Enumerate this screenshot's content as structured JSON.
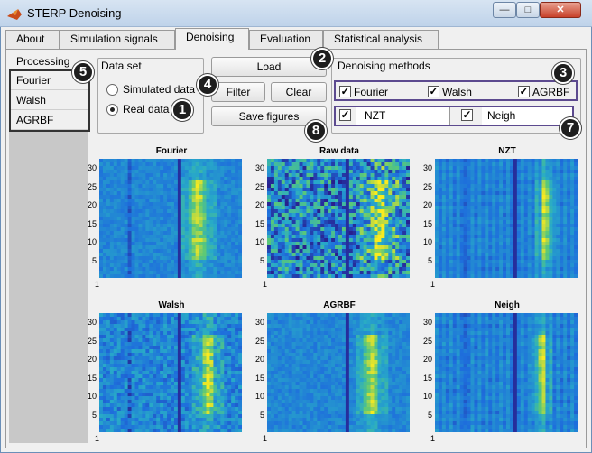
{
  "window": {
    "title": "STERP Denoising",
    "min_symbol": "—",
    "max_symbol": "□",
    "close_symbol": "✕"
  },
  "tabs": [
    {
      "label": "About"
    },
    {
      "label": "Simulation signals"
    },
    {
      "label": "Denoising"
    },
    {
      "label": "Evaluation"
    },
    {
      "label": "Statistical analysis"
    }
  ],
  "processing": {
    "label": "Processing",
    "items": [
      "Fourier",
      "Walsh",
      "AGRBF"
    ]
  },
  "dataset": {
    "title": "Data set",
    "options": [
      "Simulated data",
      "Real data"
    ],
    "selected": "Real data"
  },
  "buttons": {
    "load": "Load",
    "filter": "Filter",
    "clear": "Clear",
    "save": "Save figures"
  },
  "methods": {
    "title": "Denoising methods",
    "row1": [
      {
        "label": "Fourier",
        "checked": true
      },
      {
        "label": "Walsh",
        "checked": true
      },
      {
        "label": "AGRBF",
        "checked": true
      }
    ],
    "row2": [
      {
        "label": "NZT",
        "checked": true
      },
      {
        "label": "Neigh",
        "checked": true
      }
    ]
  },
  "badges": [
    "1",
    "2",
    "3",
    "4",
    "5",
    "7",
    "8"
  ],
  "plots": [
    {
      "title": "Fourier",
      "yticks": [
        "30",
        "25",
        "20",
        "15",
        "10",
        "5"
      ],
      "xtick": "1"
    },
    {
      "title": "Raw data",
      "yticks": [
        "30",
        "25",
        "20",
        "15",
        "10",
        "5"
      ],
      "xtick": "1"
    },
    {
      "title": "NZT",
      "yticks": [
        "30",
        "25",
        "20",
        "15",
        "10",
        "5"
      ],
      "xtick": "1"
    },
    {
      "title": "Walsh",
      "yticks": [
        "30",
        "25",
        "20",
        "15",
        "10",
        "5"
      ],
      "xtick": "1"
    },
    {
      "title": "AGRBF",
      "yticks": [
        "30",
        "25",
        "20",
        "15",
        "10",
        "5"
      ],
      "xtick": "1"
    },
    {
      "title": "Neigh",
      "yticks": [
        "30",
        "25",
        "20",
        "15",
        "10",
        "5"
      ],
      "xtick": "1"
    }
  ],
  "colors": {
    "badge": "#1e1e1e",
    "highlight_box": "#5c4a8f",
    "colormap_low": "#1b3fae",
    "colormap_high": "#f4e21c"
  }
}
